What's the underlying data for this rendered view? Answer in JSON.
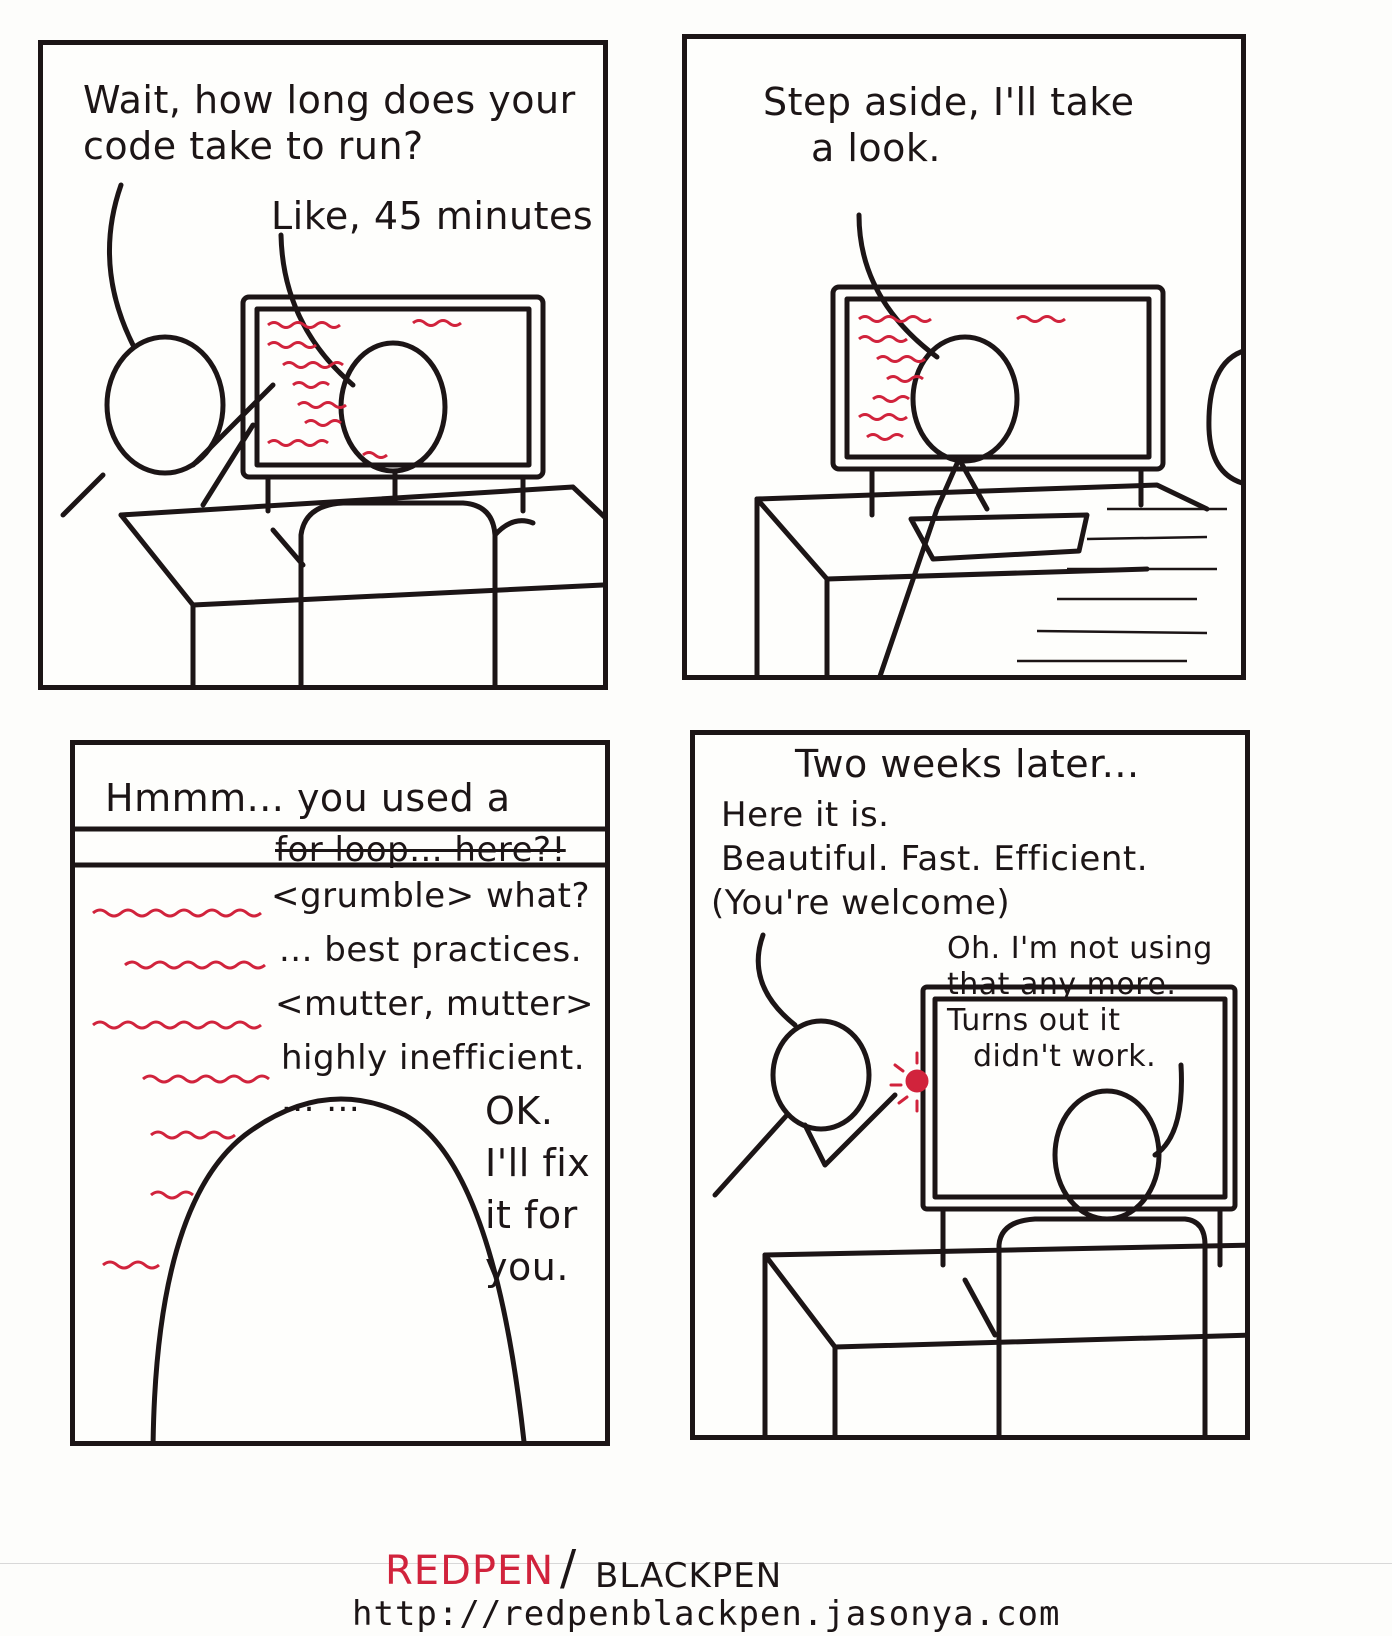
{
  "panel1": {
    "speech_a": [
      "Wait, how long does your",
      "code take to run?"
    ],
    "speech_b": "Like, 45 minutes"
  },
  "panel2": {
    "speech": [
      "Step aside, I'll take",
      "a look."
    ]
  },
  "panel3": {
    "header": "Hmmm... you used a",
    "lines": [
      "for loop... here?!",
      "<grumble> what?",
      "... best practices.",
      "<mutter, mutter>",
      "highly inefficient.",
      "...   ..."
    ],
    "reply": [
      "OK.",
      "I'll fix",
      "it for",
      "you."
    ]
  },
  "panel4": {
    "caption": "Two weeks later...",
    "speech_a": [
      "Here it is.",
      "Beautiful. Fast. Efficient.",
      "(You're welcome)"
    ],
    "speech_b": [
      "Oh. I'm not using",
      "that any more.",
      "Turns out it",
      "didn't work."
    ]
  },
  "footer": {
    "brand_red": "REDPEN",
    "brand_slash": "/",
    "brand_black": "BLACKPEN",
    "url": "http://redpenblackpen.jasonya.com"
  },
  "colors": {
    "ink": "#1c1516",
    "red": "#d1233c",
    "paper": "#fdfdfb"
  }
}
